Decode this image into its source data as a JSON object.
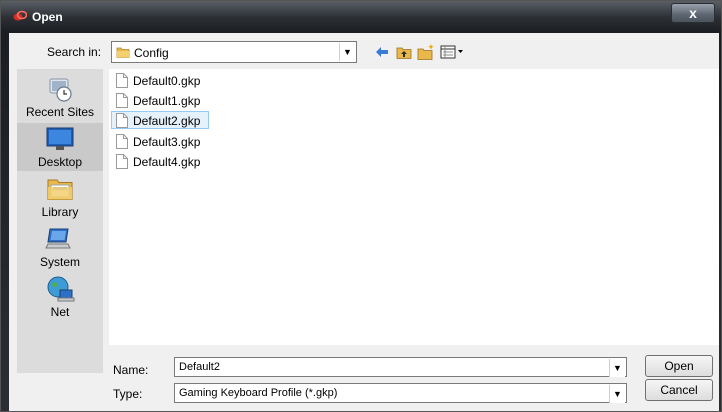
{
  "window": {
    "title": "Open",
    "close_label": "x"
  },
  "lookin": {
    "label": "Search in:",
    "value": "Config"
  },
  "places": [
    {
      "label": "Recent Sites"
    },
    {
      "label": "Desktop"
    },
    {
      "label": "Library"
    },
    {
      "label": "System"
    },
    {
      "label": "Net"
    }
  ],
  "files": [
    {
      "name": "Default0.gkp"
    },
    {
      "name": "Default1.gkp"
    },
    {
      "name": "Default2.gkp"
    },
    {
      "name": "Default3.gkp"
    },
    {
      "name": "Default4.gkp"
    }
  ],
  "name_field": {
    "label": "Name:",
    "value": "Default2"
  },
  "type_field": {
    "label": "Type:",
    "value": "Gaming  Keyboard Profile (*.gkp)"
  },
  "buttons": {
    "open": "Open",
    "cancel": "Cancel"
  },
  "colors": {
    "accent": "#99c9ef",
    "titlebar": "#2c3035",
    "folder": "#e8b84a",
    "app_icon": "#d0302a"
  }
}
